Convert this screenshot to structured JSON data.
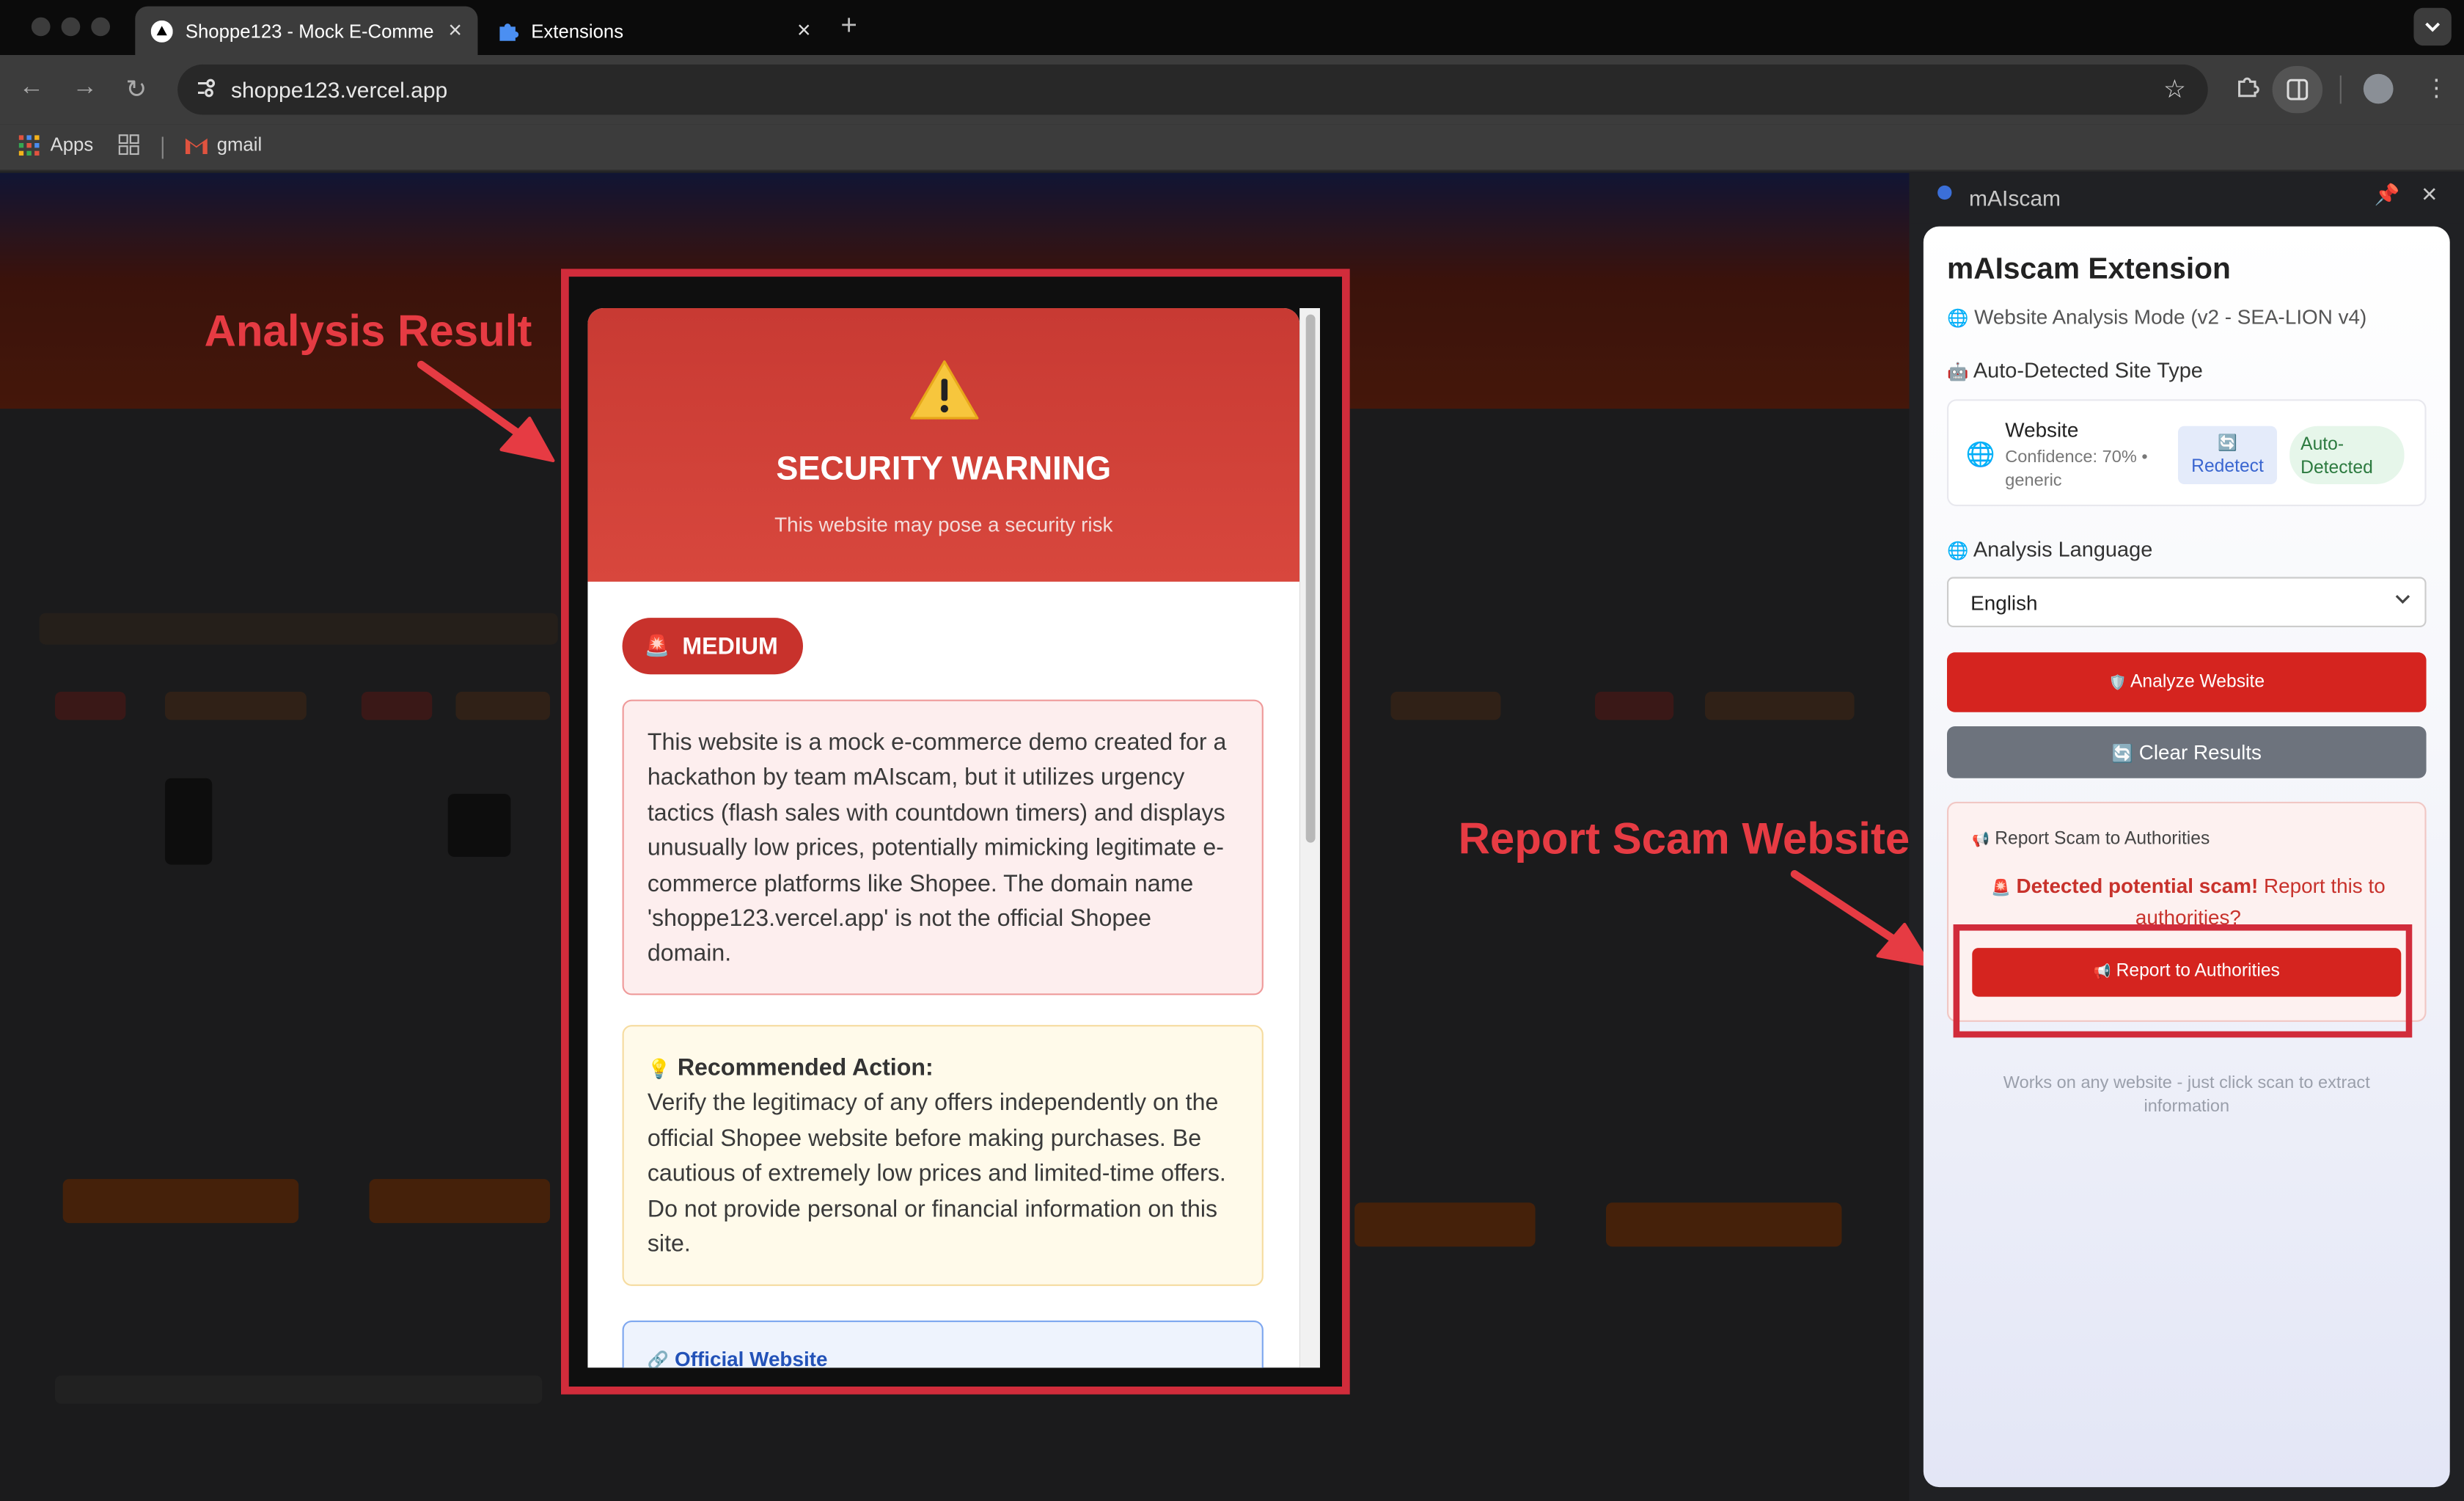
{
  "browser": {
    "tabs": [
      {
        "title": "Shoppe123 - Mock E-Comme",
        "close": "×"
      },
      {
        "title": "Extensions",
        "close": "×"
      }
    ],
    "new_tab": "+",
    "url": "shoppe123.vercel.app",
    "bookmarks": [
      {
        "label": "Apps"
      },
      {
        "label": "gmail"
      }
    ]
  },
  "warning": {
    "icon": "⚠️",
    "title": "SECURITY WARNING",
    "subtitle": "This website may pose a security risk",
    "severity": "MEDIUM",
    "severity_icon": "🚨",
    "analysis": "This website is a mock e-commerce demo created for a hackathon by team mAIscam, but it utilizes urgency tactics (flash sales with countdown timers) and displays unusually low prices, potentially mimicking legitimate e-commerce platforms like Shopee. The domain name 'shoppe123.vercel.app' is not the official Shopee domain.",
    "recommended_title": "Recommended Action:",
    "recommended_icon": "💡",
    "recommended_text": "Verify the legitimacy of any offers independently on the official Shopee website before making purchases. Be cautious of extremely low prices and limited-time offers. Do not provide personal or financial information on this site.",
    "official_label": "Official Website",
    "official_icon": "🔗"
  },
  "annotations": {
    "analysis_result": "Analysis Result",
    "report_scam": "Report Scam Website"
  },
  "panel": {
    "header": "mAIscam",
    "title": "mAIscam Extension",
    "mode_icon": "🌐",
    "mode": "Website Analysis Mode (v2 - SEA-LION v4)",
    "site_type_icon": "🤖",
    "site_type_label": "Auto-Detected Site Type",
    "site_icon": "🌐",
    "site_name": "Website",
    "confidence": "Confidence: 70% • generic",
    "redetect_icon": "🔄",
    "redetect": "Redetect",
    "auto_detected": "Auto-Detected",
    "lang_icon": "🌐",
    "lang_label": "Analysis Language",
    "language": "English",
    "analyze_icon": "🛡️",
    "analyze": "Analyze Website",
    "clear_icon": "🔄",
    "clear": "Clear Results",
    "report_heading_icon": "📢",
    "report_heading": "Report Scam to Authorities",
    "report_q_icon": "🚨",
    "report_q_strong": "Detected potential scam!",
    "report_q_rest": " Report this to authorities?",
    "report_btn_icon": "📢",
    "report_btn": "Report to Authorities",
    "footer": "Works on any website - just click scan to extract information"
  }
}
